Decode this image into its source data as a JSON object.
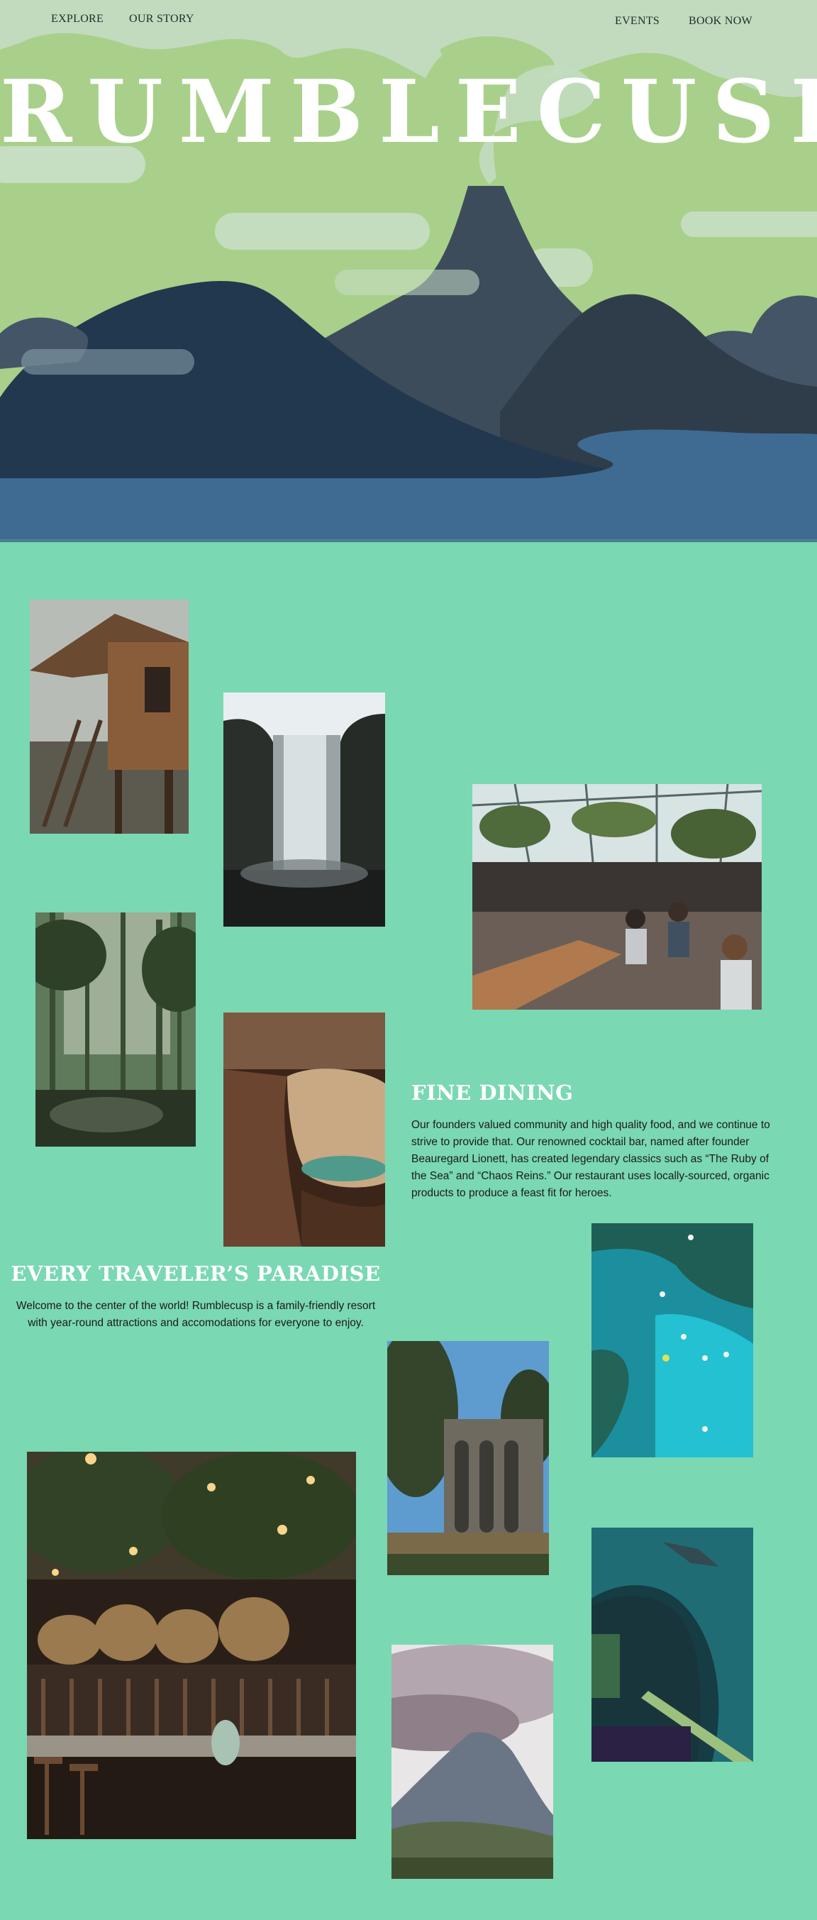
{
  "nav": {
    "explore": "EXPLORE",
    "our_story": "OUR STORY",
    "events": "EVENTS",
    "book_now": "BOOK NOW"
  },
  "hero": {
    "brand": "RUMBLECUSP"
  },
  "fine_dining": {
    "title": "FINE DINING",
    "text": "Our founders valued community and high quality food, and we continue to strive to provide that. Our renowned cocktail bar, named after founder Beauregard Lionett, has created legendary classics such as “The Ruby of the Sea” and “Chaos Reins.” Our restaurant uses locally-sourced, organic products to produce a feast fit for heroes."
  },
  "paradise": {
    "title": "EVERY TRAVELER’S PARADISE",
    "text": "Welcome to the center of the world! Rumblecusp is a family-friendly resort with year-round attractions and accomodations for everyone to enjoy."
  },
  "colors": {
    "page_bg": "#7ad8b3",
    "sky": "#a8d08a",
    "cloud": "#c2dbbf",
    "mountain_dark": "#22384f",
    "volcano": "#3d4c5b",
    "water": "#3f6b92"
  }
}
